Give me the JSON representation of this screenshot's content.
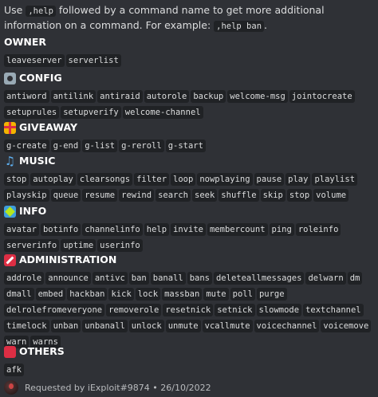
{
  "intro": {
    "text_before": "Use ",
    "help_code": ",help",
    "text_middle": " followed by a command name to get more additional information on a command. For example: ",
    "example_code": ",help ban",
    "text_after": "."
  },
  "sections": [
    {
      "title": "OWNER",
      "icon": "none",
      "commands": [
        "leaveserver",
        "serverlist"
      ]
    },
    {
      "title": "CONFIG",
      "icon": "gear-icon",
      "commands": [
        "antiword",
        "antilink",
        "antiraid",
        "autorole",
        "backup",
        "welcome-msg",
        "jointocreate",
        "setuprules",
        "setupverify",
        "welcome-channel"
      ]
    },
    {
      "title": "GIVEAWAY",
      "icon": "gift-icon",
      "commands": [
        "g-create",
        "g-end",
        "g-list",
        "g-reroll",
        "g-start"
      ]
    },
    {
      "title": "MUSIC",
      "icon": "music-notes-icon",
      "commands": [
        "stop",
        "autoplay",
        "clearsongs",
        "filter",
        "loop",
        "nowplaying",
        "pause",
        "play",
        "playlist",
        "playskip",
        "queue",
        "resume",
        "rewind",
        "search",
        "seek",
        "shuffle",
        "skip",
        "stop",
        "volume"
      ]
    },
    {
      "title": "INFO",
      "icon": "beginner-badge-icon",
      "commands": [
        "avatar",
        "botinfo",
        "channelinfo",
        "help",
        "invite",
        "membercount",
        "ping",
        "roleinfo",
        "serverinfo",
        "uptime",
        "userinfo"
      ]
    },
    {
      "title": "ADMINISTRATION",
      "icon": "no-entry-icon",
      "commands": [
        "addrole",
        "announce",
        "antivc",
        "ban",
        "banall",
        "bans",
        "deleteallmessages",
        "delwarn",
        "dm",
        "dmall",
        "embed",
        "hackban",
        "kick",
        "lock",
        "massban",
        "mute",
        "poll",
        "purge",
        "delrolefromeveryone",
        "removerole",
        "resetnick",
        "setnick",
        "slowmode",
        "textchannel",
        "timelock",
        "unban",
        "unbanall",
        "unlock",
        "unmute",
        "vcallmute",
        "voicechannel",
        "voicemove",
        "warn",
        "warns"
      ]
    },
    {
      "title": "OTHERS",
      "icon": "red-circle-icon",
      "commands": [
        "afk"
      ]
    }
  ],
  "footer": {
    "text": "Requested by iExploit#9874 • 26/10/2022"
  }
}
